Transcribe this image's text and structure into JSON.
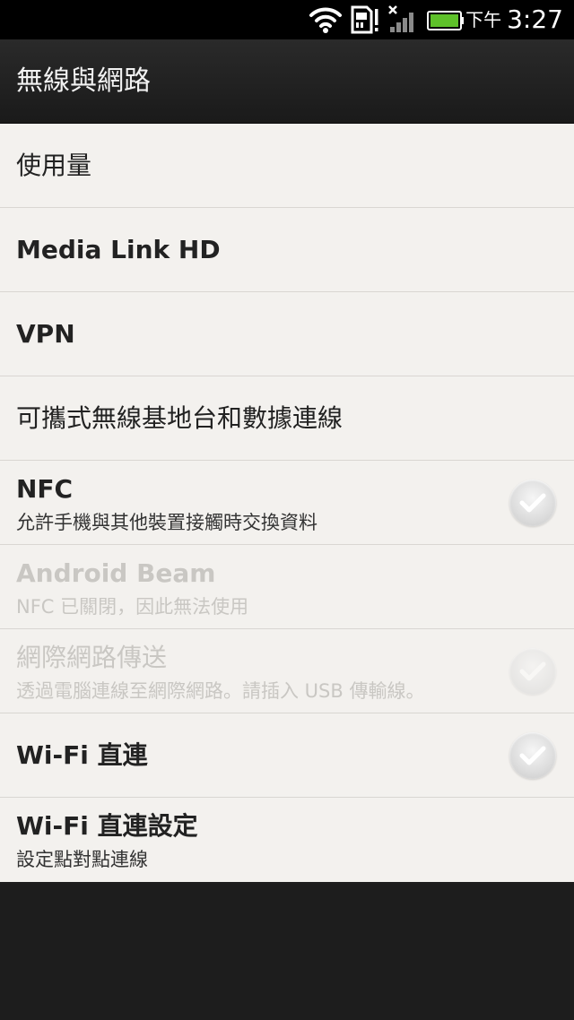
{
  "status_bar": {
    "ampm": "下午",
    "time": "3:27",
    "icons": [
      "wifi-icon",
      "sd-card-alert-icon",
      "no-signal-icon",
      "battery-icon"
    ]
  },
  "header": {
    "title": "無線與網路"
  },
  "settings": {
    "usage": {
      "title": "使用量"
    },
    "media_link": {
      "title": "Media Link HD"
    },
    "vpn": {
      "title": "VPN"
    },
    "hotspot": {
      "title": "可攜式無線基地台和數據連線"
    },
    "nfc": {
      "title": "NFC",
      "summary": "允許手機與其他裝置接觸時交換資料",
      "checked": false
    },
    "android_beam": {
      "title": "Android Beam",
      "summary": "NFC 已關閉，因此無法使用",
      "enabled": false
    },
    "internet_pass_through": {
      "title": "網際網路傳送",
      "summary": "透過電腦連線至網際網路。請插入 USB 傳輸線。",
      "enabled": false,
      "checked": false
    },
    "wifi_direct": {
      "title": "Wi-Fi 直連",
      "checked": false
    },
    "wifi_direct_settings": {
      "title": "Wi-Fi 直連設定",
      "summary": "設定點對點連線"
    }
  },
  "colors": {
    "list_bg": "#f3f1ee",
    "text": "#222222",
    "disabled_text": "#c9c7c3",
    "divider": "#d9d6d2",
    "battery": "#5ec12a"
  }
}
